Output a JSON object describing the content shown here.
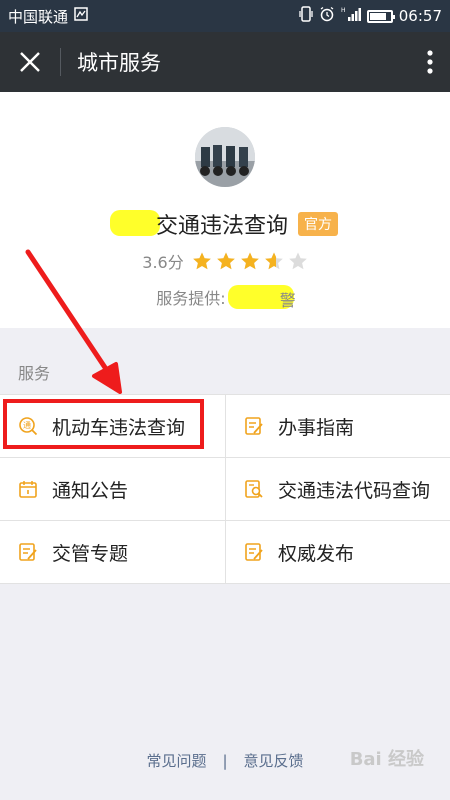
{
  "status_bar": {
    "carrier": "中国联通",
    "time": "06:57",
    "battery_level": 0.8
  },
  "nav": {
    "title": "城市服务"
  },
  "profile": {
    "name_suffix": "交通违法查询",
    "official_badge": "官方",
    "score": "3.6分",
    "rating": 3.6,
    "provider_label": "服务提供:",
    "provider_tail": "警"
  },
  "services": {
    "section_label": "服务",
    "items": [
      {
        "label": "机动车违法查询",
        "icon": "search-tong-icon"
      },
      {
        "label": "办事指南",
        "icon": "edit-note-icon"
      },
      {
        "label": "通知公告",
        "icon": "calendar-icon"
      },
      {
        "label": "交通违法代码查询",
        "icon": "doc-search-icon"
      },
      {
        "label": "交管专题",
        "icon": "edit-note-icon"
      },
      {
        "label": "权威发布",
        "icon": "edit-note-icon"
      }
    ]
  },
  "footer": {
    "faq": "常见问题",
    "separator": "|",
    "feedback": "意见反馈"
  },
  "watermark": "Bai 经验",
  "colors": {
    "accent": "#f0a31d",
    "star": "#f5b21f",
    "annotation_red": "#ee1c1c",
    "highlight": "#ffff2a"
  }
}
